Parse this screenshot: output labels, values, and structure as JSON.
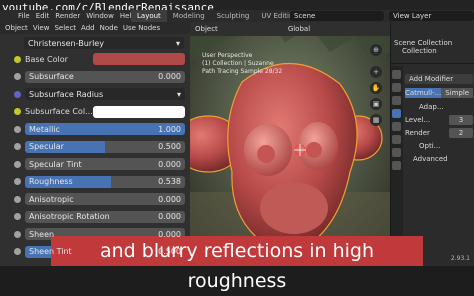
{
  "watermark": "youtube.com/c/BlenderRenaissance",
  "menu": [
    "File",
    "Edit",
    "Render",
    "Window",
    "Help"
  ],
  "workspace_tabs": [
    "Layout",
    "Modeling",
    "Sculpting",
    "UV Editing"
  ],
  "active_tab": "Layout",
  "scene_name": "Scene",
  "view_layer": "View Layer",
  "node_editor": {
    "toolbar": [
      "Object",
      "View",
      "Select",
      "Add",
      "Node",
      "Use Nodes"
    ],
    "subsurface_method": "Christensen-Burley",
    "properties": [
      {
        "label": "Base Color",
        "type": "color",
        "color": "#b04a48",
        "socket": "#c7c729"
      },
      {
        "label": "Subsurface",
        "type": "value",
        "value": "0.000",
        "fill": 0,
        "socket": "#a1a1a1"
      },
      {
        "label": "Subsurface Radius",
        "type": "dropdown",
        "socket": "#6363c7"
      },
      {
        "label": "Subsurface Col...",
        "type": "color",
        "color": "#ffffff",
        "socket": "#c7c729"
      },
      {
        "label": "Metallic",
        "type": "value",
        "value": "1.000",
        "fill": 1.0,
        "socket": "#a1a1a1"
      },
      {
        "label": "Specular",
        "type": "value",
        "value": "0.500",
        "fill": 0.5,
        "socket": "#a1a1a1"
      },
      {
        "label": "Specular Tint",
        "type": "value",
        "value": "0.000",
        "fill": 0,
        "socket": "#a1a1a1"
      },
      {
        "label": "Roughness",
        "type": "value",
        "value": "0.538",
        "fill": 0.538,
        "socket": "#a1a1a1"
      },
      {
        "label": "Anisotropic",
        "type": "value",
        "value": "0.000",
        "fill": 0,
        "socket": "#a1a1a1"
      },
      {
        "label": "Anisotropic Rotation",
        "type": "value",
        "value": "0.000",
        "fill": 0,
        "socket": "#a1a1a1"
      },
      {
        "label": "Sheen",
        "type": "value",
        "value": "0.000",
        "fill": 0,
        "socket": "#a1a1a1"
      },
      {
        "label": "Sheen Tint",
        "type": "value",
        "value": "0.500",
        "fill": 0.5,
        "socket": "#a1a1a1"
      }
    ]
  },
  "viewport": {
    "header": [
      "Object",
      "Global"
    ],
    "info_lines": [
      "User Perspective",
      "(1) Collection | Suzanne",
      "Path Tracing Sample 28/32"
    ]
  },
  "properties_panel": {
    "outliner_items": [
      "Scene Collection",
      "Collection"
    ],
    "add_modifier": "Add Modifier",
    "mod_tabs": [
      "Catmull-...",
      "Simple"
    ],
    "adaptive": "Adap...",
    "levels_label": "Level...",
    "levels_value": "3",
    "render_label": "Render",
    "render_value": "2",
    "optimal_label": "Opti...",
    "advanced": "Advanced"
  },
  "caption": "and blurry reflections in high roughness",
  "version": "2.93.1",
  "colors": {
    "accent": "#4772b3",
    "caption_bg": "#c0393b",
    "mesh": "#b84b4a"
  }
}
